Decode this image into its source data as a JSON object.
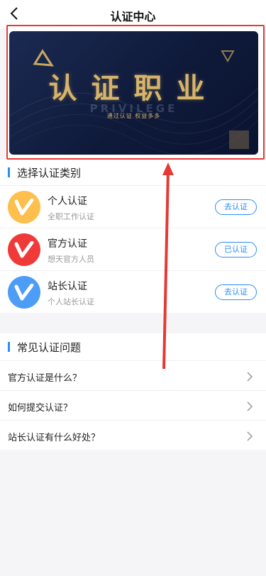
{
  "header": {
    "title": "认证中心"
  },
  "banner": {
    "title": "认证职业",
    "english": "PRIVILEGE",
    "subtitle": "通过认证 权益多多"
  },
  "categories": {
    "section_title": "选择认证类别",
    "items": [
      {
        "title": "个人认证",
        "subtitle": "全职工作认证",
        "button": "去认证",
        "color": "#ffbf4d"
      },
      {
        "title": "官方认证",
        "subtitle": "想天官方人员",
        "button": "已认证",
        "color": "#f03a3a"
      },
      {
        "title": "站长认证",
        "subtitle": "个人站长认证",
        "button": "去认证",
        "color": "#4d9cf6"
      }
    ]
  },
  "faq": {
    "section_title": "常见认证问题",
    "items": [
      {
        "question": "官方认证是什么？"
      },
      {
        "question": "如何提交认证？"
      },
      {
        "question": "站长认证有什么好处？"
      }
    ]
  },
  "colors": {
    "accent": "#2b8ef3",
    "highlight": "#e53935",
    "gold": "#d7b46a"
  },
  "icons": {
    "back": "back-chevron-icon",
    "avatar": "v-logo-icon",
    "faq": "chevron-right-icon"
  }
}
